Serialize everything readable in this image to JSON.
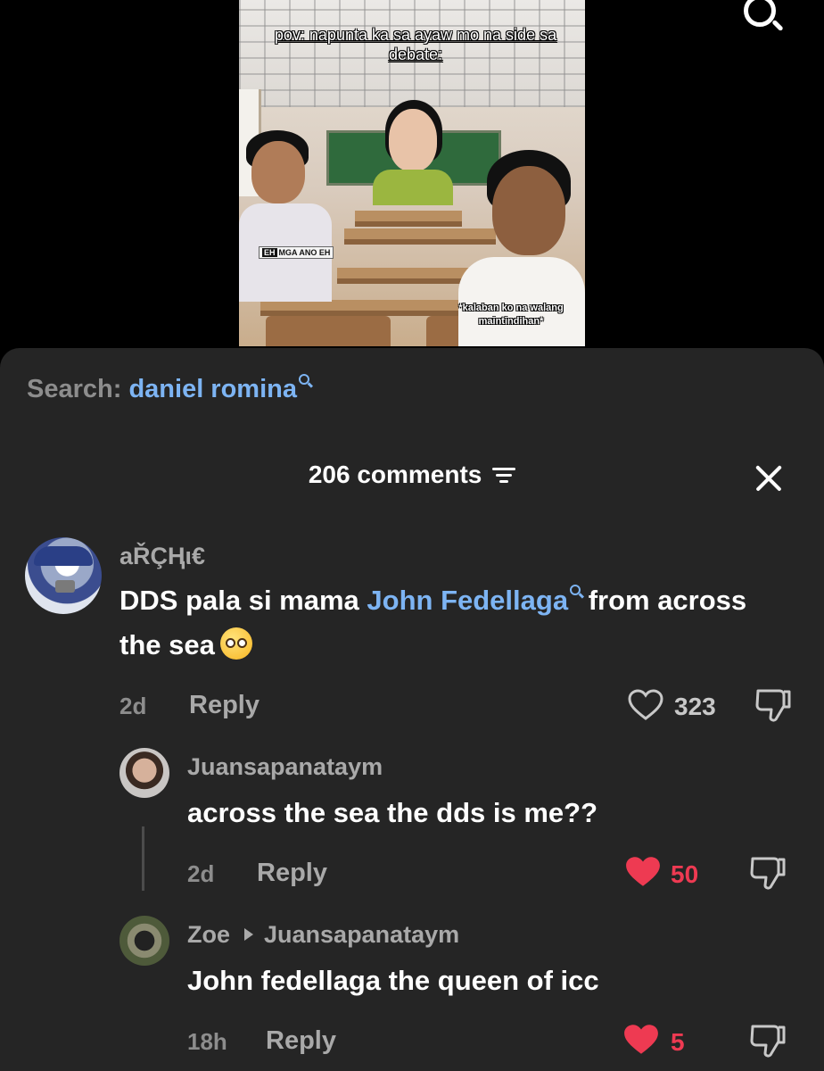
{
  "video": {
    "title": "pov: napunta ka sa ayaw mo na side sa debate:",
    "caption_right": "*kalaban ko na walang maintindihan*",
    "sticker": "MGA ANO EH"
  },
  "search": {
    "label": "Search:",
    "term": "daniel romina"
  },
  "header": {
    "count_label": "206 comments"
  },
  "comments": [
    {
      "username": "aŘÇⱧι€",
      "text_before": "DDS pala si mama ",
      "mention": "John Fedellaga",
      "text_after": " from across the sea",
      "time": "2d",
      "reply": "Reply",
      "likes": "323",
      "liked": false
    },
    {
      "username": "Juansapanataym",
      "text": "across the sea the dds is me??",
      "time": "2d",
      "reply": "Reply",
      "likes": "50",
      "liked": true
    },
    {
      "username": "Zoe",
      "reply_to": "Juansapanataym",
      "text": "John fedellaga the queen of icc",
      "time": "18h",
      "reply": "Reply",
      "likes": "5",
      "liked": true
    }
  ],
  "colors": {
    "background": "#000000",
    "sheet": "#252525",
    "accent_blue": "#7db4f3",
    "like_red": "#ee3a52",
    "muted": "#a9a9a9"
  }
}
